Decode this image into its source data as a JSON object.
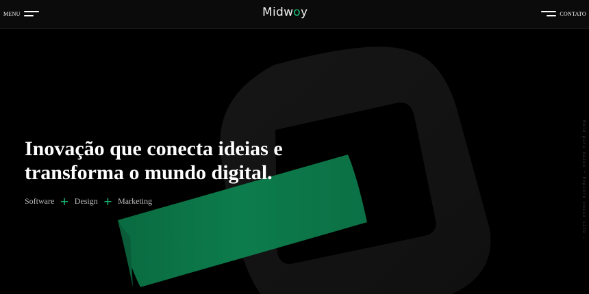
{
  "header": {
    "menu_label": "MENU",
    "logo_prefix": "Midw",
    "logo_accent": "o",
    "logo_suffix": "y",
    "contact_label": "CONTATO"
  },
  "hero": {
    "title_line1": "Inovação que conecta ideias e",
    "title_line2": "transforma o mundo digital.",
    "tags": [
      "Software",
      "Design",
      "Marketing"
    ],
    "tag_separator": "+"
  },
  "side_text": "Role para baixo • Explore nosso site —",
  "colors": {
    "background": "#000000",
    "header": "#0b0b0b",
    "accent": "#19c27a",
    "ribbon": "#0c7a4b",
    "ring": "#141414"
  },
  "icons": {
    "menu": "hamburger-icon",
    "contact": "hamburger-icon"
  }
}
